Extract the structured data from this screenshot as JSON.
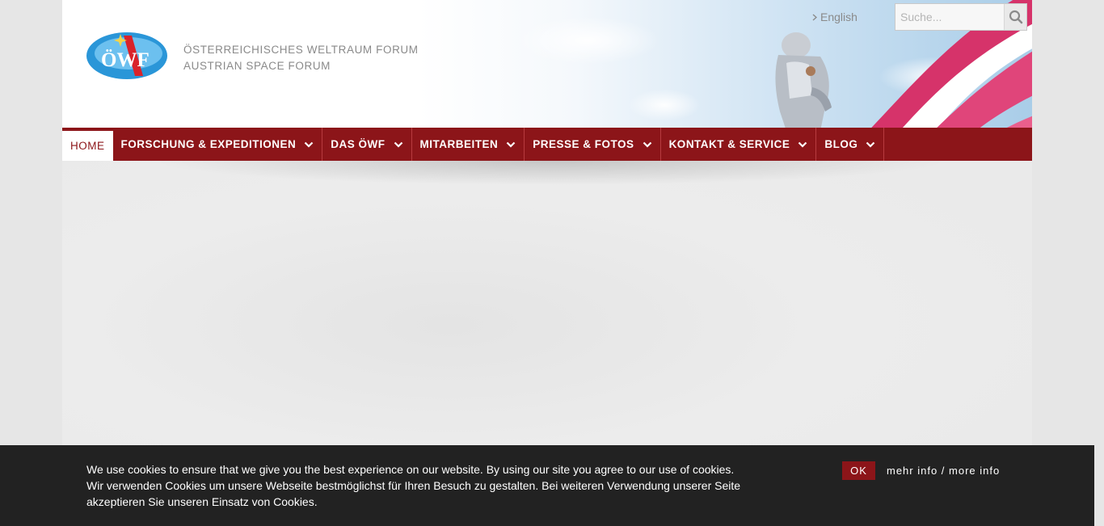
{
  "header": {
    "org_name_de": "ÖSTERREICHISCHES WELTRAUM FORUM",
    "org_name_en": "AUSTRIAN SPACE FORUM",
    "logo_text": "ÖWF",
    "language_link": "English",
    "search_placeholder": "Suche..."
  },
  "nav": {
    "items": [
      {
        "label": "HOME"
      },
      {
        "label": "FORSCHUNG & EXPEDITIONEN"
      },
      {
        "label": "DAS ÖWF"
      },
      {
        "label": "MITARBEITEN"
      },
      {
        "label": "PRESSE & FOTOS"
      },
      {
        "label": "KONTAKT & SERVICE"
      },
      {
        "label": "BLOG"
      }
    ]
  },
  "cookie": {
    "line1": "We use cookies to ensure that we give you the best experience on our website. By using our site you agree to our use of cookies.",
    "line2": "Wir verwenden Cookies um unsere Webseite bestmöglichst für Ihren Besuch zu gestalten. Bei weiteren Verwendung unserer Seite akzeptieren Sie unseren Einsatz von Cookies.",
    "ok_label": "OK",
    "more_label": "mehr info / more info"
  },
  "colors": {
    "brand_red": "#8c1519",
    "cookie_bg": "#222222"
  }
}
